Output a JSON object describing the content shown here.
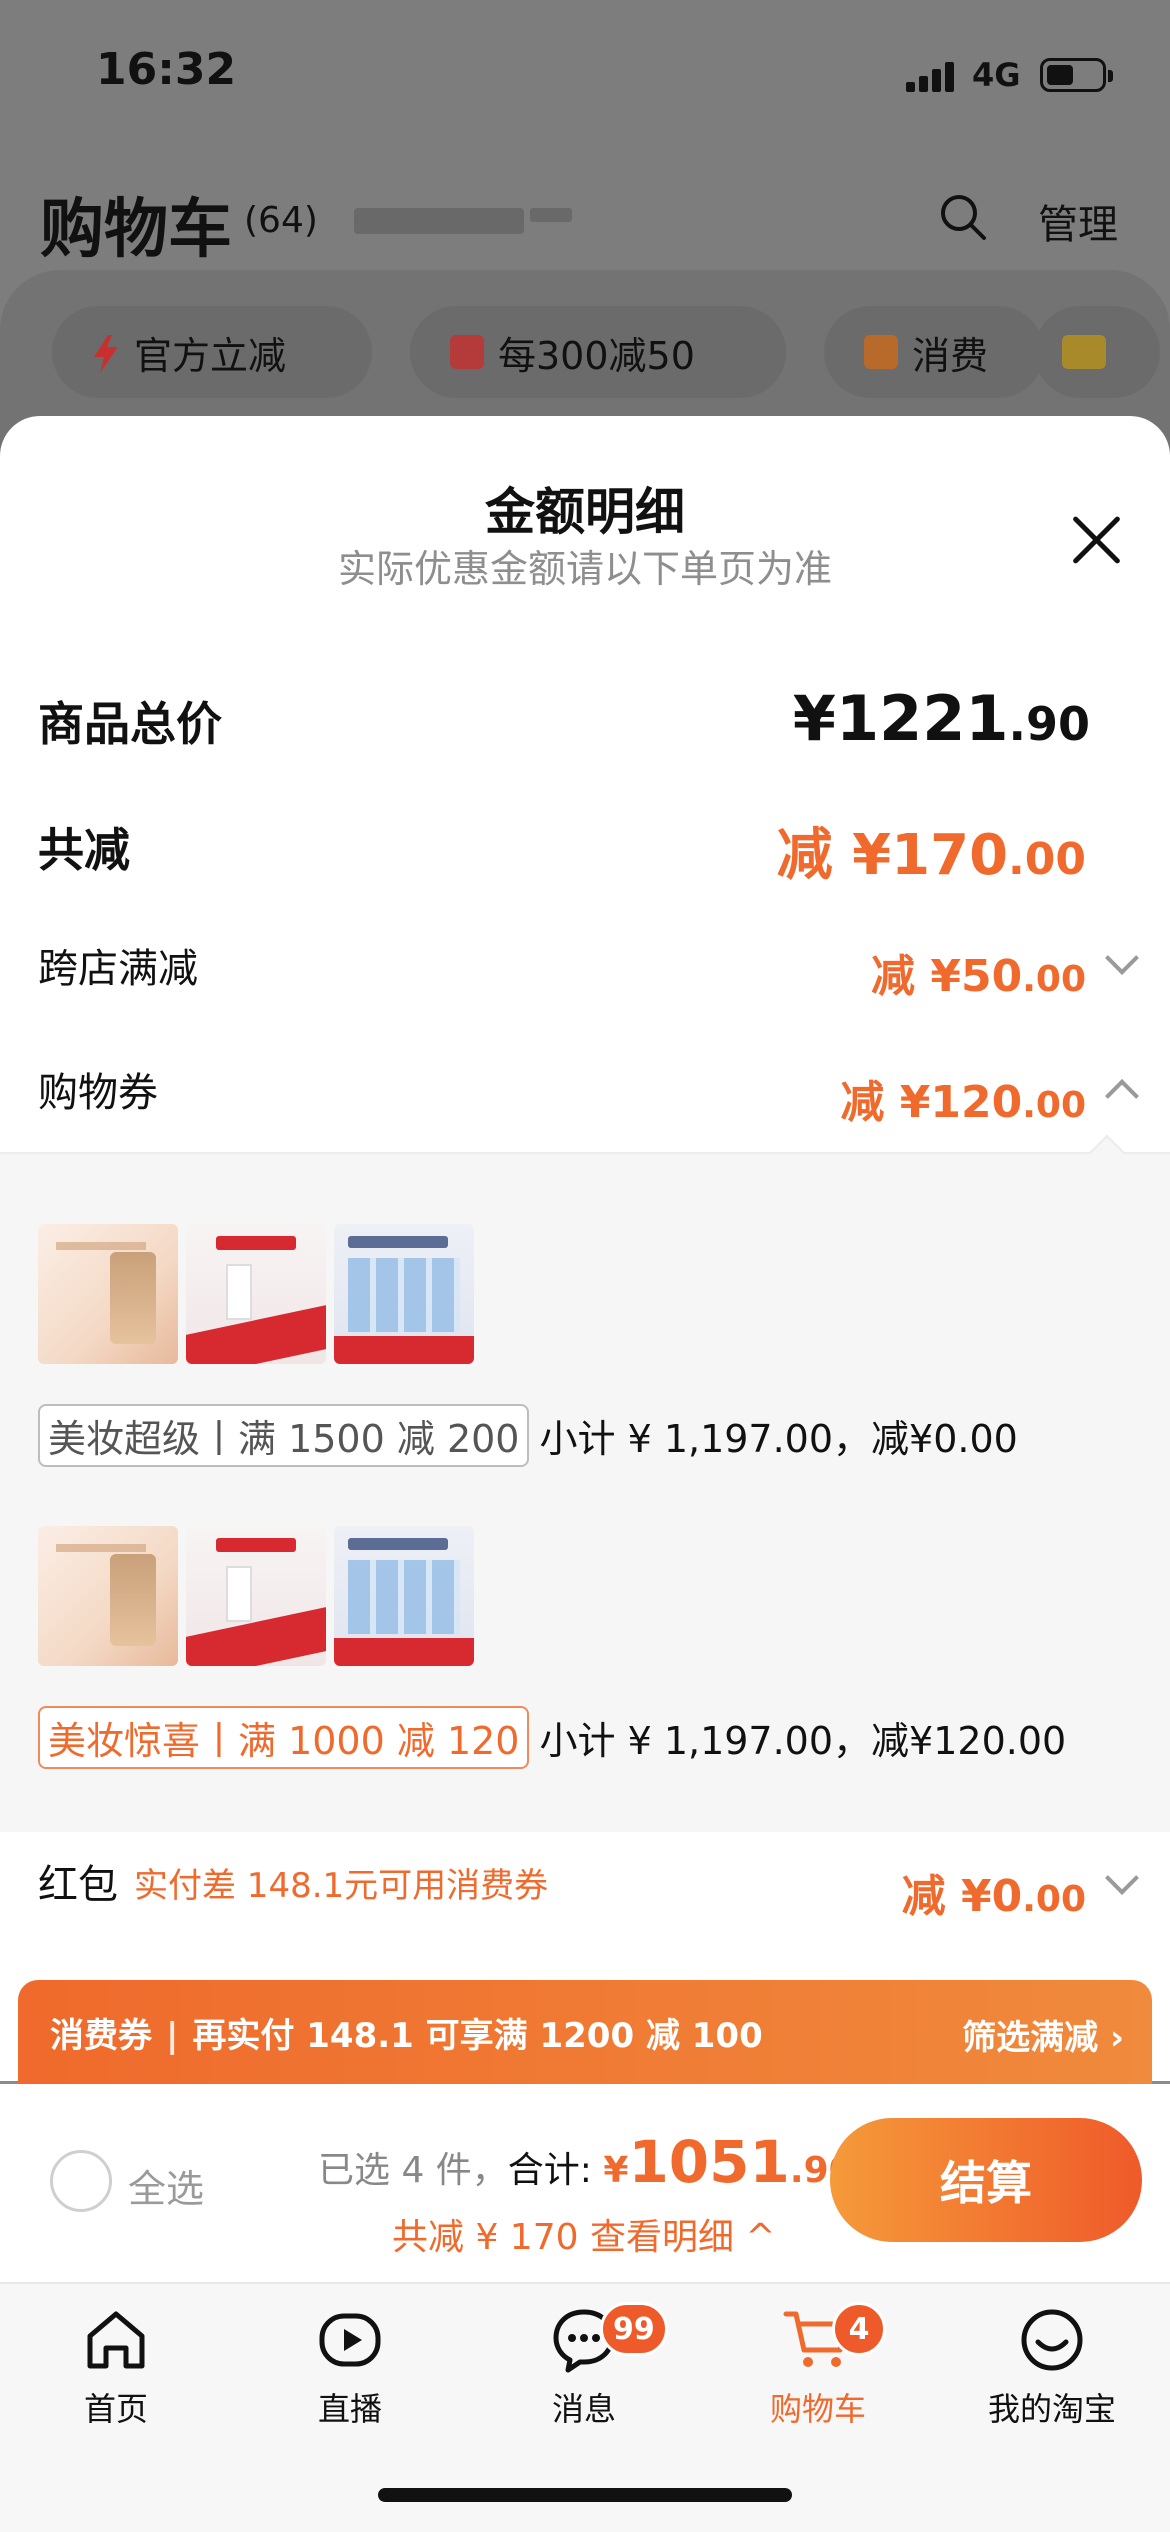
{
  "status_bar": {
    "time": "16:32",
    "network": "4G"
  },
  "background": {
    "title": "购物车",
    "count": "(64)",
    "manage_label": "管理",
    "chips": [
      {
        "label": "官方立减",
        "icon": "lightning-icon"
      },
      {
        "label": "每300减50",
        "icon": "store-icon"
      },
      {
        "label": "消费",
        "icon": "coupon-icon"
      }
    ]
  },
  "sheet": {
    "title": "金额明细",
    "subtitle": "实际优惠金额请以下单页为准",
    "total_price": {
      "label": "商品总价",
      "currency": "¥",
      "integer": "1221",
      "decimal": ".90"
    },
    "total_discount": {
      "label": "共减",
      "prefix": "减 ¥",
      "integer": "170",
      "decimal": ".00"
    },
    "cross_store": {
      "label": "跨店满减",
      "prefix": "减 ¥",
      "integer": "50",
      "decimal": ".00"
    },
    "shopping_coupon": {
      "label": "购物券",
      "prefix": "减 ¥",
      "integer": "120",
      "decimal": ".00"
    },
    "coupon_groups": [
      {
        "tag": "美妆超级丨满 1500 减 200",
        "subtotal": "小计 ¥ 1,197.00，减¥0.00",
        "active": false
      },
      {
        "tag": "美妆惊喜丨满 1000 减 120",
        "subtotal": "小计 ¥ 1,197.00，减¥120.00",
        "active": true
      }
    ],
    "red_packet": {
      "label": "红包",
      "note": "实付差 148.1元可用消费券",
      "prefix": "减 ¥",
      "integer": "0",
      "decimal": ".00"
    }
  },
  "banner": {
    "tag": "消费券",
    "text": "再实付 148.1 可享满 1200 减 100",
    "link": "筛选满减 ›"
  },
  "checkout": {
    "select_all": "全选",
    "selected": "已选 4 件，",
    "total_label": "合计:",
    "currency": "¥",
    "integer": "1051",
    "decimal": ".90",
    "detail": "共减 ¥ 170  查看明细 ^",
    "button": "结算"
  },
  "tabbar": {
    "items": [
      {
        "label": "首页",
        "icon": "home-icon"
      },
      {
        "label": "直播",
        "icon": "live-icon"
      },
      {
        "label": "消息",
        "icon": "message-icon",
        "badge": "99"
      },
      {
        "label": "购物车",
        "icon": "cart-icon",
        "badge": "4",
        "active": true
      },
      {
        "label": "我的淘宝",
        "icon": "profile-icon"
      }
    ]
  },
  "colors": {
    "accent": "#ef6a2c",
    "button_gradient_start": "#f59a3a",
    "button_gradient_end": "#ef5a2a"
  }
}
